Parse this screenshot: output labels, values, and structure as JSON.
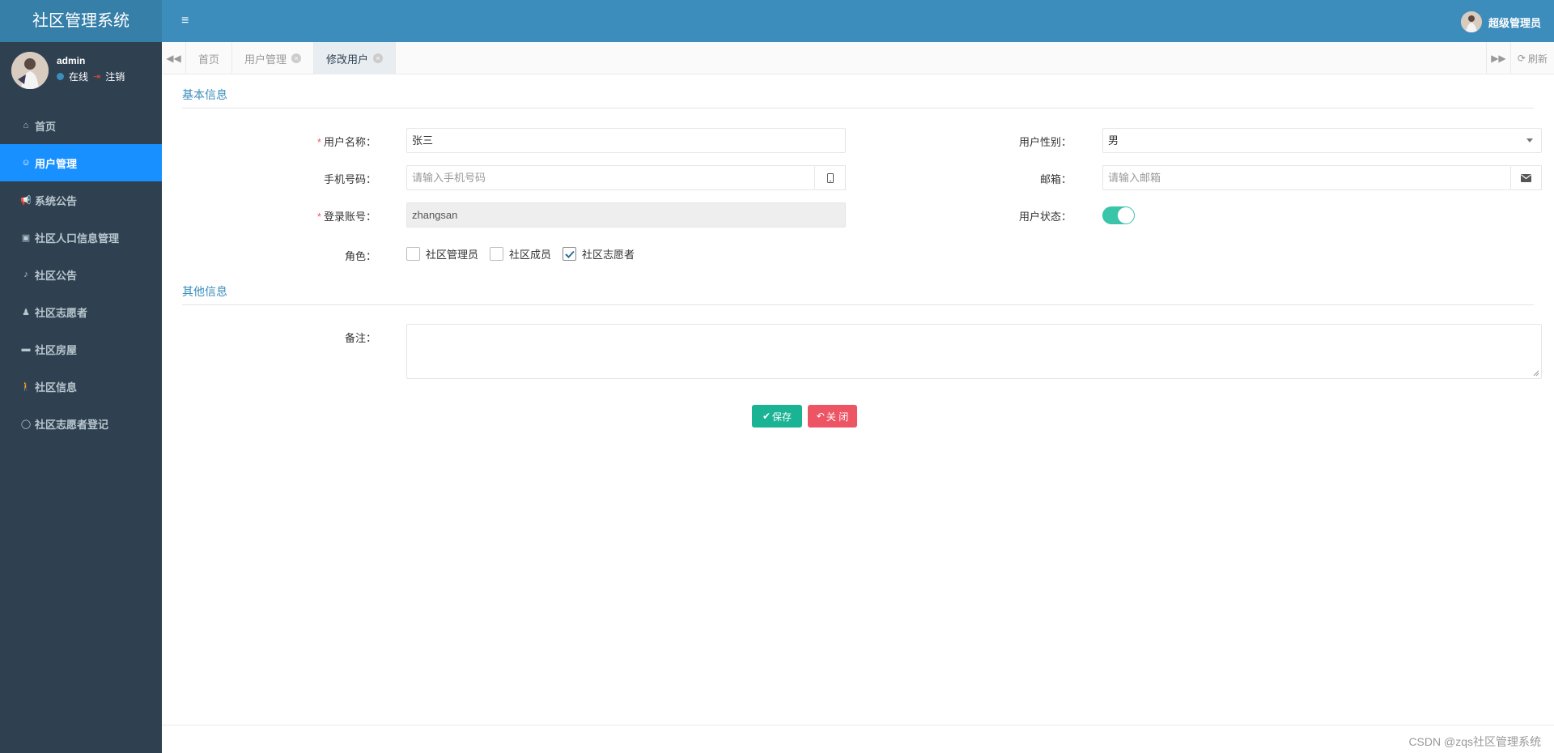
{
  "app": {
    "title": "社区管理系统"
  },
  "user_panel": {
    "username": "admin",
    "online": "在线",
    "logout": "注销"
  },
  "menu": [
    {
      "label": "首页",
      "icon": "home-icon",
      "glyph": "⌂",
      "active": false
    },
    {
      "label": "用户管理",
      "icon": "user-icon",
      "glyph": "☺",
      "active": true
    },
    {
      "label": "系统公告",
      "icon": "bullhorn-icon",
      "glyph": "📢",
      "active": false
    },
    {
      "label": "社区人口信息管理",
      "icon": "id-card-icon",
      "glyph": "▣",
      "active": false
    },
    {
      "label": "社区公告",
      "icon": "bell-icon",
      "glyph": "♪",
      "active": false
    },
    {
      "label": "社区志愿者",
      "icon": "person-icon",
      "glyph": "♟",
      "active": false
    },
    {
      "label": "社区房屋",
      "icon": "bed-icon",
      "glyph": "▬",
      "active": false
    },
    {
      "label": "社区信息",
      "icon": "walking-icon",
      "glyph": "🚶",
      "active": false
    },
    {
      "label": "社区志愿者登记",
      "icon": "comment-icon",
      "glyph": "◯",
      "active": false
    }
  ],
  "topbar": {
    "admin_name": "超级管理员"
  },
  "tabs": [
    {
      "label": "首页",
      "closable": false,
      "active": false
    },
    {
      "label": "用户管理",
      "closable": true,
      "active": false
    },
    {
      "label": "修改用户",
      "closable": true,
      "active": true
    }
  ],
  "tab_controls": {
    "refresh": "刷新"
  },
  "form": {
    "section_basic": "基本信息",
    "section_other": "其他信息",
    "username_label": "用户名称：",
    "username_value": "张三",
    "gender_label": "用户性别：",
    "gender_value": "男",
    "phone_label": "手机号码：",
    "phone_placeholder": "请输入手机号码",
    "email_label": "邮箱：",
    "email_placeholder": "请输入邮箱",
    "account_label": "登录账号：",
    "account_value": "zhangsan",
    "status_label": "用户状态：",
    "status_on": true,
    "role_label": "角色：",
    "roles": [
      {
        "label": "社区管理员",
        "checked": false
      },
      {
        "label": "社区成员",
        "checked": false
      },
      {
        "label": "社区志愿者",
        "checked": true
      }
    ],
    "remark_label": "备注：",
    "remark_value": "",
    "save_button": "保存",
    "close_button": "关 闭"
  },
  "footer": {
    "watermark": "CSDN @zqs社区管理系统"
  },
  "colors": {
    "sidebar": "#2f4050",
    "header": "#3c8dbc",
    "active_menu": "#1890ff",
    "save": "#1ab394",
    "close": "#ed5565",
    "switch": "#3ac4a9"
  }
}
